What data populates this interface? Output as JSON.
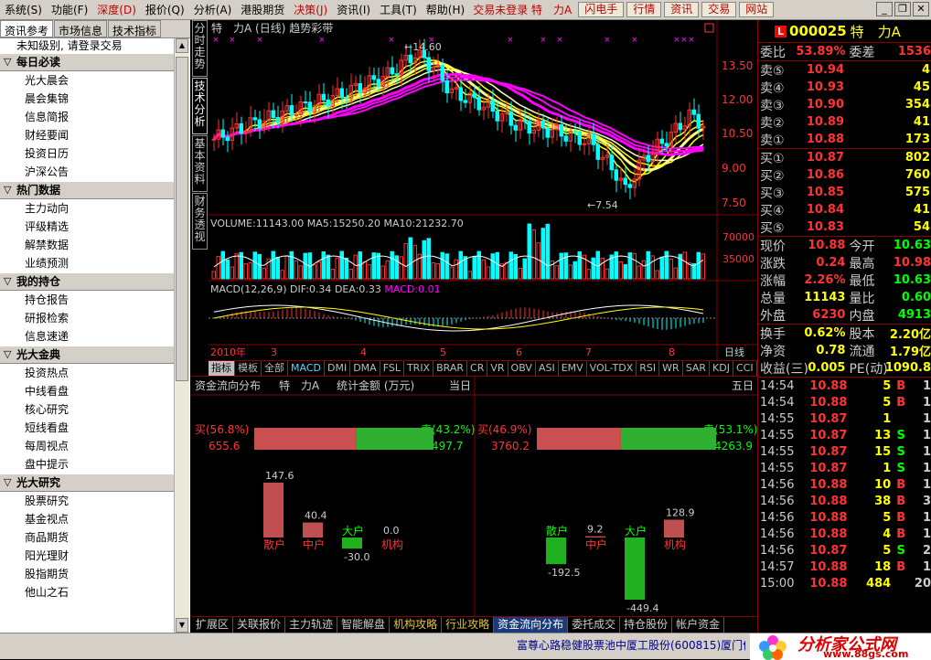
{
  "menu": {
    "items": [
      "系统(S)",
      "功能(F)",
      "深度(D)",
      "报价(Q)",
      "分析(A)",
      "港股期货",
      "决策(J)",
      "资讯(I)",
      "工具(T)",
      "帮助(H)"
    ],
    "marquee": "交易未登录 特　力A",
    "buttons": [
      "闪电手",
      "行情",
      "资讯",
      "交易",
      "网站"
    ]
  },
  "left": {
    "tabs": [
      "资讯参考",
      "市场信息",
      "技术指标"
    ],
    "login_msg": "未知级别, 请登录交易",
    "sections": [
      {
        "title": "每日必读",
        "items": [
          "光大晨会",
          "晨会集锦",
          "信息简报",
          "财经要闻",
          "投资日历",
          "沪深公告"
        ]
      },
      {
        "title": "热门数据",
        "items": [
          "主力动向",
          "评级精选",
          "解禁数据",
          "业绩预测"
        ]
      },
      {
        "title": "我的持仓",
        "items": [
          "持仓报告",
          "研报检索",
          "信息速递"
        ]
      },
      {
        "title": "光大金典",
        "items": [
          "投资热点",
          "中线看盘",
          "核心研究",
          "短线看盘",
          "每周视点",
          "盘中提示"
        ]
      },
      {
        "title": "光大研究",
        "items": [
          "股票研究",
          "基金视点",
          "商品期货",
          "阳光理财",
          "股指期货",
          "他山之石"
        ]
      }
    ]
  },
  "vtabs": [
    "分时走势",
    "技术分析",
    "基本资料",
    "财务透视"
  ],
  "chart": {
    "title": "特　力A (日线) 趋势彩带",
    "price_ticks": [
      "13.50",
      "12.00",
      "10.50",
      "9.00",
      "7.50"
    ],
    "high_label": "14.60",
    "low_label": "7.54",
    "volume_label": "VOLUME:11143.00",
    "ma5_label": "MA5:15250.20",
    "ma10_label": "MA10:21232.70",
    "vol_ticks": [
      "70000",
      "35000"
    ],
    "macd_prefix": "MACD(12,26,9)",
    "dif_label": "DIF:0.34",
    "dea_label": "DEA:0.33",
    "macd_label": "MACD:0.01",
    "year_label": "2010年",
    "months": [
      "3",
      "4",
      "5",
      "6",
      "7",
      "8"
    ],
    "period_label": "日线",
    "colors": {
      "ma_band_yellow": "#ffff00",
      "ma_band_magenta": "#ff00ff",
      "up": "#ff3030",
      "down": "#00ffff"
    }
  },
  "indicator_tabs": [
    "指标",
    "模板",
    "全部",
    "MACD",
    "DMI",
    "DMA",
    "FSL",
    "TRIX",
    "BRAR",
    "CR",
    "VR",
    "OBV",
    "ASI",
    "EMV",
    "VOL-TDX",
    "RSI",
    "WR",
    "SAR",
    "KDJ",
    "CCI",
    "ROC"
  ],
  "flow": {
    "title": "资金流向分布",
    "stock": "特　力A",
    "unit": "统计金额 (万元)",
    "day_label": "当日",
    "week_label": "五日",
    "day": {
      "buy_label": "买(56.8%)",
      "buy_amount": "655.6",
      "sell_label": "卖(43.2%)",
      "sell_amount": "497.7",
      "buy_pct": 56.8,
      "bars": [
        {
          "name": "散户",
          "value": 147.6,
          "label": "147.6"
        },
        {
          "name": "中户",
          "value": 40.4,
          "label": "40.4"
        },
        {
          "name": "大户",
          "value": -30.0,
          "label": "-30.0"
        },
        {
          "name": "机构",
          "value": 0.0,
          "label": "0.0"
        }
      ]
    },
    "week": {
      "buy_label": "买(46.9%)",
      "buy_amount": "3760.2",
      "sell_label": "卖(53.1%)",
      "sell_amount": "4263.9",
      "buy_pct": 46.9,
      "bars": [
        {
          "name": "散户",
          "value": -192.5,
          "label": "-192.5"
        },
        {
          "name": "中户",
          "value": 9.2,
          "label": "9.2"
        },
        {
          "name": "大户",
          "value": -449.4,
          "label": "-449.4"
        },
        {
          "name": "机构",
          "value": 128.9,
          "label": "128.9"
        }
      ]
    }
  },
  "bottom_tabs": [
    "扩展区",
    "关联报价",
    "主力轨迹",
    "智能解盘",
    "机构攻略",
    "行业攻略",
    "资金流向分布",
    "委托成交",
    "持仓股份",
    "帐户资金"
  ],
  "right": {
    "code": "000025",
    "name": "特　力A",
    "weibi_label": "委比",
    "weibi": "53.89%",
    "weicha_label": "委差",
    "weicha": "1536",
    "asks": [
      {
        "label": "卖⑤",
        "price": "10.94",
        "vol": "4"
      },
      {
        "label": "卖④",
        "price": "10.93",
        "vol": "45"
      },
      {
        "label": "卖③",
        "price": "10.90",
        "vol": "354"
      },
      {
        "label": "卖②",
        "price": "10.89",
        "vol": "41"
      },
      {
        "label": "卖①",
        "price": "10.88",
        "vol": "173"
      }
    ],
    "bids": [
      {
        "label": "买①",
        "price": "10.87",
        "vol": "802"
      },
      {
        "label": "买②",
        "price": "10.86",
        "vol": "760"
      },
      {
        "label": "买③",
        "price": "10.85",
        "vol": "575"
      },
      {
        "label": "买④",
        "price": "10.84",
        "vol": "41"
      },
      {
        "label": "买⑤",
        "price": "10.83",
        "vol": "54"
      }
    ],
    "stats": [
      {
        "l1": "现价",
        "v1": "10.88",
        "c1": "red",
        "l2": "今开",
        "v2": "10.63",
        "c2": "green"
      },
      {
        "l1": "涨跌",
        "v1": "0.24",
        "c1": "red",
        "l2": "最高",
        "v2": "10.98",
        "c2": "red"
      },
      {
        "l1": "涨幅",
        "v1": "2.26%",
        "c1": "red",
        "l2": "最低",
        "v2": "10.63",
        "c2": "green"
      },
      {
        "l1": "总量",
        "v1": "11143",
        "c1": "yel",
        "l2": "量比",
        "v2": "0.60",
        "c2": "green"
      },
      {
        "l1": "外盘",
        "v1": "6230",
        "c1": "red",
        "l2": "内盘",
        "v2": "4913",
        "c2": "green"
      }
    ],
    "stats2": [
      {
        "l1": "换手",
        "v1": "0.62%",
        "l2": "股本",
        "v2": "2.20亿"
      },
      {
        "l1": "净资",
        "v1": "0.78",
        "l2": "流通",
        "v2": "1.79亿"
      },
      {
        "l1": "收益(三)",
        "v1": "0.005",
        "l2": "PE(动)",
        "v2": "1090.8"
      }
    ],
    "ticks": [
      {
        "time": "14:54",
        "price": "10.88",
        "vol": "5",
        "bs": "B",
        "n": "1"
      },
      {
        "time": "14:54",
        "price": "10.88",
        "vol": "5",
        "bs": "B",
        "n": "1"
      },
      {
        "time": "14:55",
        "price": "10.87",
        "vol": "1",
        "bs": "",
        "n": "1"
      },
      {
        "time": "14:55",
        "price": "10.87",
        "vol": "13",
        "bs": "S",
        "n": "1"
      },
      {
        "time": "14:55",
        "price": "10.87",
        "vol": "15",
        "bs": "S",
        "n": "1"
      },
      {
        "time": "14:55",
        "price": "10.87",
        "vol": "1",
        "bs": "S",
        "n": "1"
      },
      {
        "time": "14:56",
        "price": "10.88",
        "vol": "10",
        "bs": "B",
        "n": "1"
      },
      {
        "time": "14:56",
        "price": "10.88",
        "vol": "38",
        "bs": "B",
        "n": "3"
      },
      {
        "time": "14:56",
        "price": "10.88",
        "vol": "5",
        "bs": "B",
        "n": "1"
      },
      {
        "time": "14:56",
        "price": "10.88",
        "vol": "4",
        "bs": "B",
        "n": "1"
      },
      {
        "time": "14:56",
        "price": "10.87",
        "vol": "5",
        "bs": "S",
        "n": "2"
      },
      {
        "time": "14:57",
        "price": "10.88",
        "vol": "18",
        "bs": "B",
        "n": "1"
      },
      {
        "time": "15:00",
        "price": "10.88",
        "vol": "484",
        "bs": "",
        "n": "20"
      }
    ]
  },
  "status": {
    "scroll_text": "富尊心路稳健股票池中厦工股份(600815)厦门信",
    "logo_text": "分析家公式网",
    "logo_url": "www.88gs.com"
  }
}
